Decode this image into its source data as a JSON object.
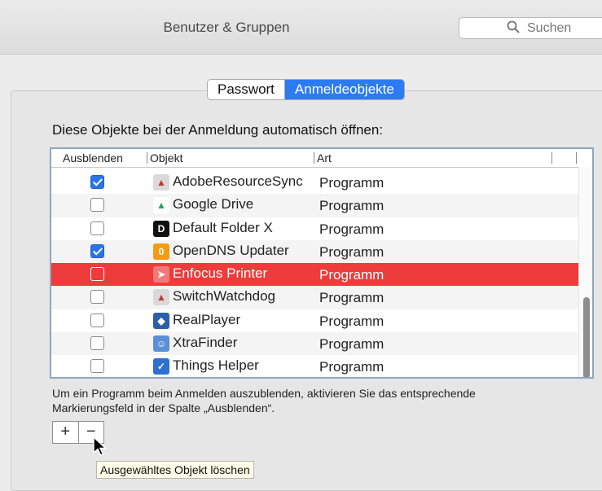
{
  "window": {
    "title": "Benutzer & Gruppen"
  },
  "search": {
    "placeholder": "Suchen"
  },
  "tabs": {
    "passwort": "Passwort",
    "anmeldeobjekte": "Anmeldeobjekte"
  },
  "heading": "Diese Objekte bei der Anmeldung automatisch öffnen:",
  "table": {
    "columns": {
      "hide": "Ausblenden",
      "object": "Objekt",
      "kind": "Art"
    },
    "rows": [
      {
        "name": "AdobeResourceSync",
        "kind": "Programm",
        "hidden": true,
        "icon": "adobe-sync-icon"
      },
      {
        "name": "Google Drive",
        "kind": "Programm",
        "hidden": false,
        "icon": "google-drive-icon"
      },
      {
        "name": "Default Folder X",
        "kind": "Programm",
        "hidden": false,
        "icon": "default-folder-icon"
      },
      {
        "name": "OpenDNS Updater",
        "kind": "Programm",
        "hidden": true,
        "icon": "opendns-icon"
      },
      {
        "name": "Enfocus Printer",
        "kind": "Programm",
        "hidden": false,
        "icon": "enfocus-icon",
        "selected": true
      },
      {
        "name": "SwitchWatchdog",
        "kind": "Programm",
        "hidden": false,
        "icon": "switch-watchdog-icon"
      },
      {
        "name": "RealPlayer",
        "kind": "Programm",
        "hidden": false,
        "icon": "realplayer-icon"
      },
      {
        "name": "XtraFinder",
        "kind": "Programm",
        "hidden": false,
        "icon": "xtrafinder-icon"
      },
      {
        "name": "Things Helper",
        "kind": "Programm",
        "hidden": false,
        "icon": "things-icon"
      }
    ]
  },
  "hint_line1": "Um ein Programm beim Anmelden auszublenden, aktivieren Sie das entsprechende",
  "hint_line2": "Markierungsfeld in der Spalte „Ausblenden“.",
  "buttons": {
    "add": "+",
    "remove": "−"
  },
  "tooltip": "Ausgewähltes Objekt löschen",
  "colors": {
    "selection": "#ee3b3b",
    "accent": "#2d7bf2"
  }
}
